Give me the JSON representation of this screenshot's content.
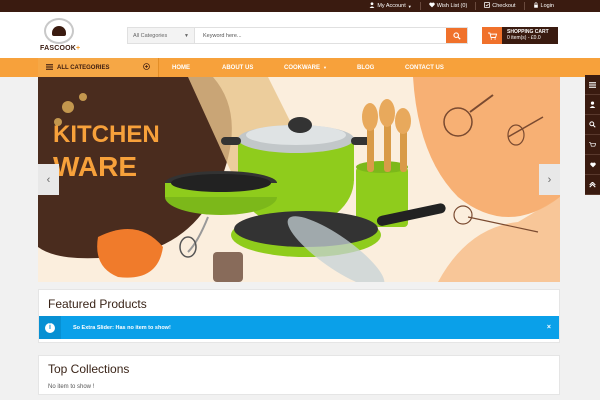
{
  "topbar": {
    "account": "My Account",
    "wishlist": "Wish List (0)",
    "checkout": "Checkout",
    "login": "Login"
  },
  "logo": {
    "brand_a": "FASCOOK",
    "brand_b": "+"
  },
  "search": {
    "category": "All Categories",
    "placeholder": "Keyword here..."
  },
  "cart": {
    "title": "SHOPPING CART",
    "summary": "0 item(s) - £0.0"
  },
  "nav": {
    "all_categories": "ALL CATEGORIES",
    "items": [
      "HOME",
      "ABOUT US",
      "COOKWARE",
      "BLOG",
      "CONTACT US"
    ]
  },
  "slider": {
    "headline_1": "KITCHEN",
    "headline_2": "WARE"
  },
  "featured": {
    "title": "Featured Products",
    "alert": "So Extra Slider: Has no item to show!",
    "close": "×"
  },
  "collections": {
    "title": "Top Collections",
    "empty": "No item to show !"
  },
  "colors": {
    "dark_brown": "#3a1b10",
    "orange": "#f0712b",
    "nav_orange": "#f7a13b",
    "info_blue": "#0aa0e9",
    "pot_green": "#8fcc1c"
  },
  "icons": [
    "user-icon",
    "heart-icon",
    "checkout-icon",
    "lock-icon",
    "search-icon",
    "cart-icon",
    "list-icon",
    "plus-circle-icon",
    "chevron-left-icon",
    "chevron-right-icon",
    "info-icon",
    "close-icon",
    "chevron-up-icon"
  ]
}
